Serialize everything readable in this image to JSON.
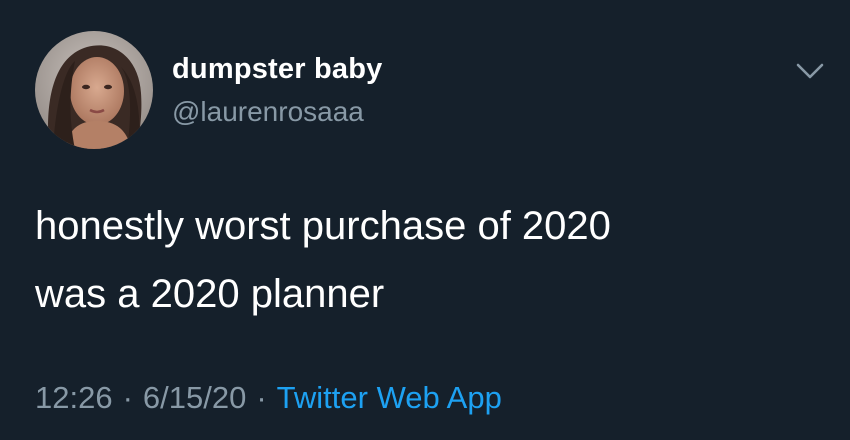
{
  "tweet": {
    "author": {
      "display_name": "dumpster baby",
      "handle": "@laurenrosaaa"
    },
    "text_lines": [
      "honestly worst purchase of 2020",
      "was a 2020 planner"
    ],
    "time": "12:26",
    "date": "6/15/20",
    "separator": "·",
    "source": "Twitter Web App"
  },
  "colors": {
    "background": "#15202b",
    "primary_text": "#ffffff",
    "secondary_text": "#8899a6",
    "link": "#1da1f2"
  },
  "icons": {
    "more": "chevron-down-icon"
  }
}
